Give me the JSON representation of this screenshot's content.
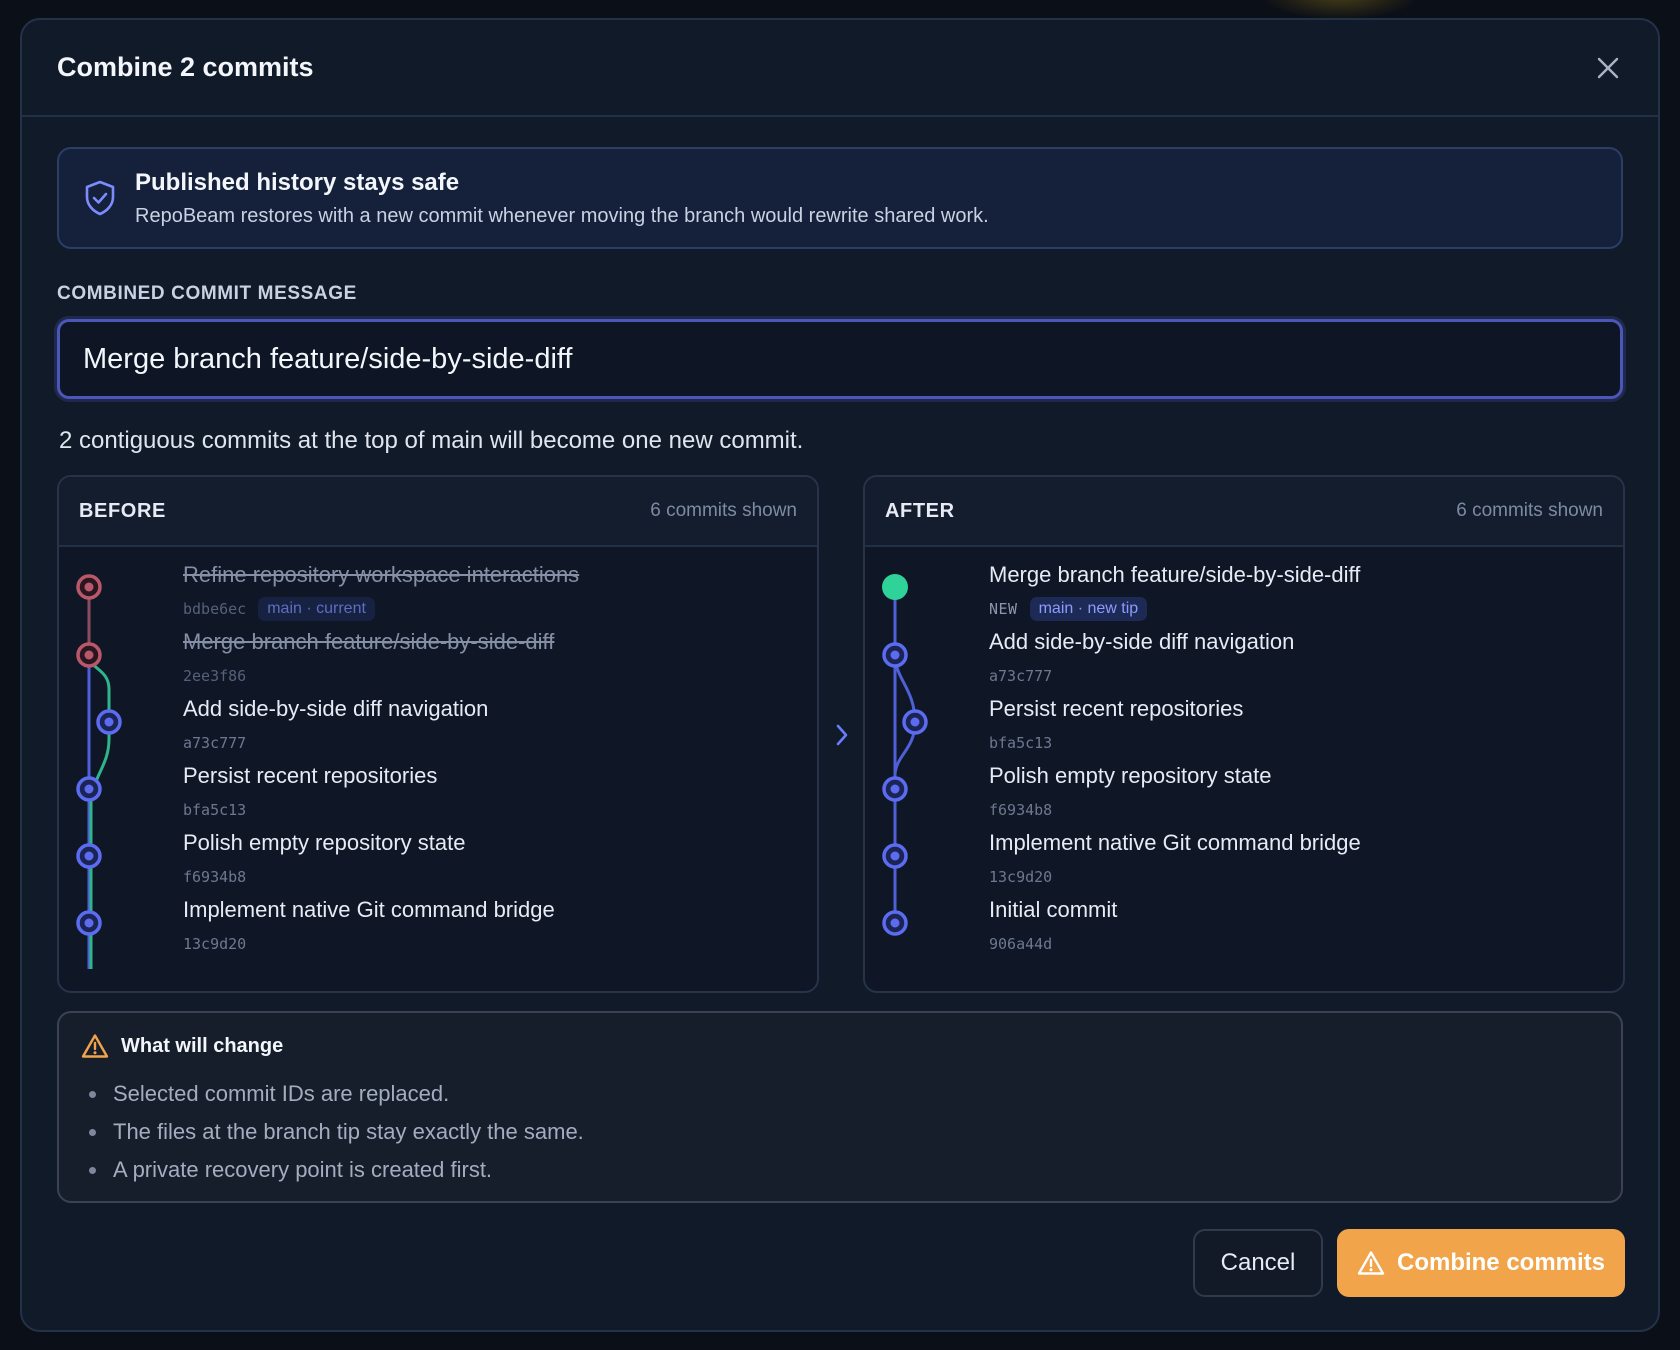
{
  "dialog": {
    "title": "Combine 2 commits",
    "close_icon": "close-icon"
  },
  "banner": {
    "icon": "shield-check-icon",
    "title": "Published history stays safe",
    "description": "RepoBeam restores with a new commit whenever moving the branch would rewrite shared work."
  },
  "message": {
    "label": "COMBINED COMMIT MESSAGE",
    "value": "Merge branch feature/side-by-side-diff"
  },
  "summary": "2 contiguous commits at the top of main will become one new commit.",
  "before": {
    "label": "BEFORE",
    "count": "6 commits shown",
    "commits": [
      {
        "title": "Refine repository workspace interactions",
        "sha": "bdbe6ec",
        "ref": "main · current",
        "removed": true
      },
      {
        "title": "Merge branch feature/side-by-side-diff",
        "sha": "2ee3f86",
        "removed": true
      },
      {
        "title": "Add side-by-side diff navigation",
        "sha": "a73c777"
      },
      {
        "title": "Persist recent repositories",
        "sha": "bfa5c13"
      },
      {
        "title": "Polish empty repository state",
        "sha": "f6934b8"
      },
      {
        "title": "Implement native Git command bridge",
        "sha": "13c9d20"
      }
    ]
  },
  "after": {
    "label": "AFTER",
    "count": "6 commits shown",
    "commits": [
      {
        "title": "Merge branch feature/side-by-side-diff",
        "tag": "NEW",
        "ref": "main · new tip"
      },
      {
        "title": "Add side-by-side diff navigation",
        "sha": "a73c777"
      },
      {
        "title": "Persist recent repositories",
        "sha": "bfa5c13"
      },
      {
        "title": "Polish empty repository state",
        "sha": "f6934b8"
      },
      {
        "title": "Implement native Git command bridge",
        "sha": "13c9d20"
      },
      {
        "title": "Initial commit",
        "sha": "906a44d"
      }
    ]
  },
  "changes": {
    "icon": "warning-icon",
    "title": "What will change",
    "items": [
      "Selected commit IDs are replaced.",
      "The files at the branch tip stay exactly the same.",
      "A private recovery point is created first."
    ]
  },
  "actions": {
    "cancel": "Cancel",
    "confirm": "Combine commits"
  },
  "colors": {
    "accent": "#5b6cf0",
    "removed": "#b9586a",
    "branch": "#2fb58a",
    "new_node": "#2fd39a",
    "primary": "#f2a44b"
  }
}
